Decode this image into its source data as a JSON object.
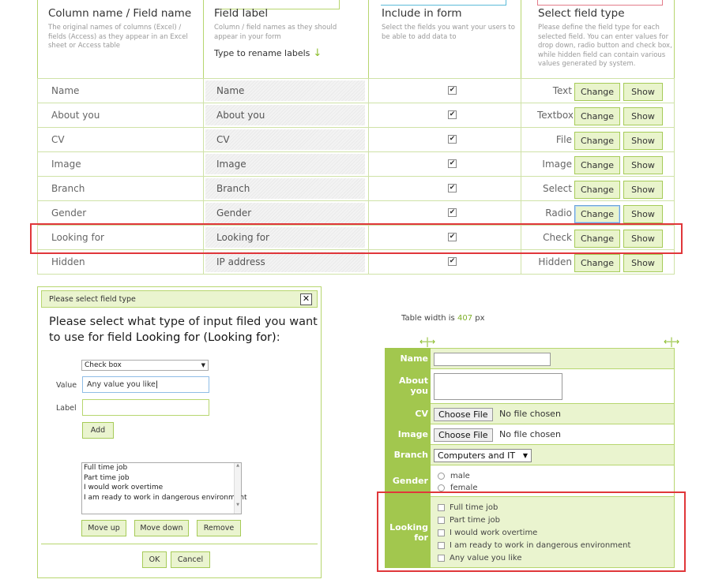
{
  "header": {
    "col1_title": "Column name / Field name",
    "col1_desc": "The original names of columns (Excel) / fields (Access) as they appear in an Excel sheet or Access table",
    "col2_title": "Field label",
    "col2_desc": "Column / field names as they should appear in your form",
    "col2_hint": "Type to rename labels",
    "col2_hint_icon": "arrow-down",
    "col3_title": "Include in form",
    "col3_desc": "Select the fields you want your users to be able to add data to",
    "col4_title": "Select field type",
    "col4_desc": "Please define the field type for each selected field. You can enter values for drop down, radio button and check box, while hidden field can contain various values generated by system."
  },
  "rows": [
    {
      "name": "Name",
      "label": "Name",
      "type": "Text",
      "change": "Change",
      "show": "Show"
    },
    {
      "name": "About you",
      "label": "About you",
      "type": "Textbox",
      "change": "Change",
      "show": "Show"
    },
    {
      "name": "CV",
      "label": "CV",
      "type": "File",
      "change": "Change",
      "show": "Show"
    },
    {
      "name": "Image",
      "label": "Image",
      "type": "Image",
      "change": "Change",
      "show": "Show"
    },
    {
      "name": "Branch",
      "label": "Branch",
      "type": "Select",
      "change": "Change",
      "show": "Show"
    },
    {
      "name": "Gender",
      "label": "Gender",
      "type": "Radio",
      "change": "Change",
      "show": "Show"
    },
    {
      "name": "Looking for",
      "label": "Looking for",
      "type": "Check",
      "change": "Change",
      "show": "Show"
    },
    {
      "name": "Hidden",
      "label": "IP address",
      "type": "Hidden",
      "change": "Change",
      "show": "Show"
    }
  ],
  "dialog": {
    "title": "Please select field type",
    "close": "✕",
    "message_prefix": "Please select what type of input filed you want to use for field ",
    "message_field": "Looking for (Looking for)",
    "message_suffix": ":",
    "type_selected": "Check box",
    "value_label": "Value",
    "value_input": "Any value you like",
    "label_label": "Label",
    "label_input": "",
    "add": "Add",
    "options": [
      "Full time job",
      "Part time job",
      "I would work overtime",
      "I am ready to work in dangerous environment"
    ],
    "move_up": "Move up",
    "move_down": "Move down",
    "remove": "Remove",
    "ok": "OK",
    "cancel": "Cancel"
  },
  "preview": {
    "width_prefix": "Table width is",
    "width_value": "407",
    "width_unit": "px",
    "labels": {
      "name": "Name",
      "about": "About you",
      "cv": "CV",
      "image": "Image",
      "branch": "Branch",
      "gender": "Gender",
      "looking": "Looking for"
    },
    "choose_file": "Choose File",
    "no_file": "No file chosen",
    "branch_value": "Computers and IT",
    "gender_options": [
      "male",
      "female"
    ],
    "looking_options": [
      "Full time job",
      "Part time job",
      "I would work overtime",
      "I am ready to work in dangerous environment",
      "Any value you like"
    ]
  },
  "colors": {
    "accent": "#a2c74e",
    "accent_light": "#eaf4cf",
    "highlight": "#e0373a"
  }
}
